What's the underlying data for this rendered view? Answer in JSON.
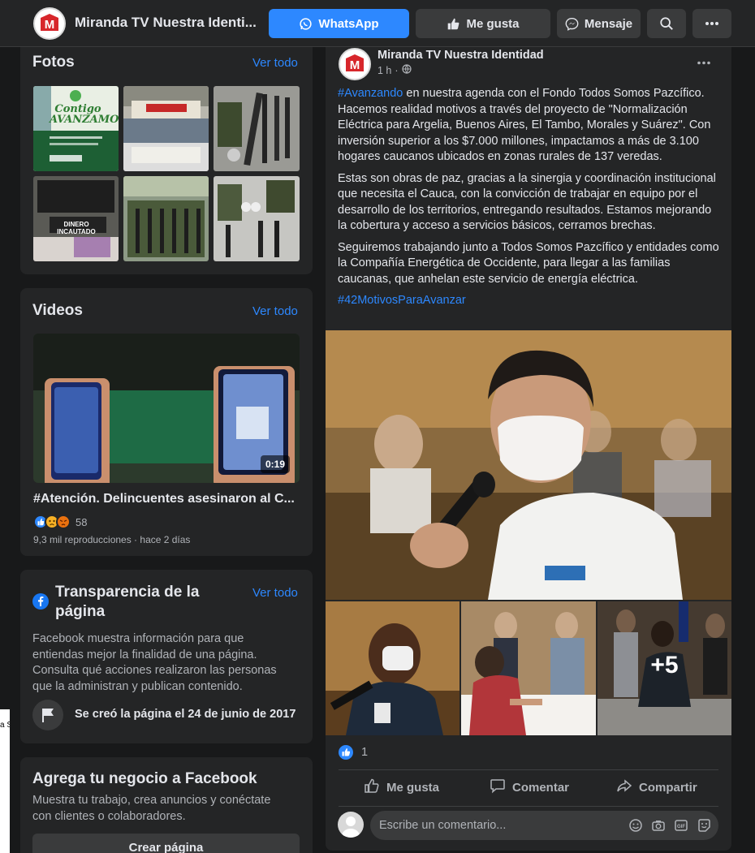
{
  "topbar": {
    "page_name": "Miranda TV Nuestra Identi...",
    "whatsapp_label": "WhatsApp",
    "like_label": "Me gusta",
    "message_label": "Mensaje"
  },
  "photos": {
    "title": "Fotos",
    "see_all": "Ver todo",
    "thumb1_text": "Contigo AVANZAMOS",
    "thumb5_text": "DINERO INCAUTADO"
  },
  "videos": {
    "title": "Videos",
    "see_all": "Ver todo",
    "duration": "0:19",
    "video_title": "#Atención. Delincuentes asesinaron al C...",
    "reaction_count": "58",
    "meta": "9,3 mil reproducciones · hace 2 días"
  },
  "transparency": {
    "title": "Transparencia de la página",
    "see_all": "Ver todo",
    "body": "Facebook muestra información para que entiendas mejor la finalidad de una página. Consulta qué acciones realizaron las personas que la administran y publican contenido.",
    "created": "Se creó la página el 24 de junio de 2017"
  },
  "business": {
    "title": "Agrega tu negocio a Facebook",
    "body": "Muestra tu trabajo, crea anuncios y conéctate con clientes o colaboradores.",
    "button": "Crear página"
  },
  "post": {
    "author": "Miranda TV Nuestra Identidad",
    "time": "1 h",
    "p1_hashtag": "#Avanzando",
    "p1_text": " en nuestra agenda con el Fondo Todos Somos Pazcífico. Hacemos realidad motivos a través del proyecto de \"Normalización Eléctrica para Argelia, Buenos Aires, El Tambo, Morales y Suárez\". Con inversión superior a los $7.000 millones, impactamos a más de 3.100 hogares caucanos ubicados en zonas rurales de 137 veredas.",
    "p2": "Estas son obras de paz, gracias a la sinergia y coordinación institucional que necesita el Cauca, con la convicción de trabajar en equipo por el desarrollo de los territorios, entregando resultados. Estamos mejorando la cobertura y acceso a servicios básicos, cerramos brechas.",
    "p3": "Seguiremos trabajando junto a Todos Somos Pazcífico y entidades como la Compañía Energética de Occidente, para llegar a las familias caucanas, que anhelan este servicio de energía eléctrica.",
    "p4_hashtag": "#42MotivosParaAvanzar",
    "more_photos": "+5",
    "like_count": "1",
    "like_action": "Me gusta",
    "comment_action": "Comentar",
    "share_action": "Compartir",
    "comment_placeholder": "Escribe un comentario..."
  },
  "left_edge_text": "a S"
}
